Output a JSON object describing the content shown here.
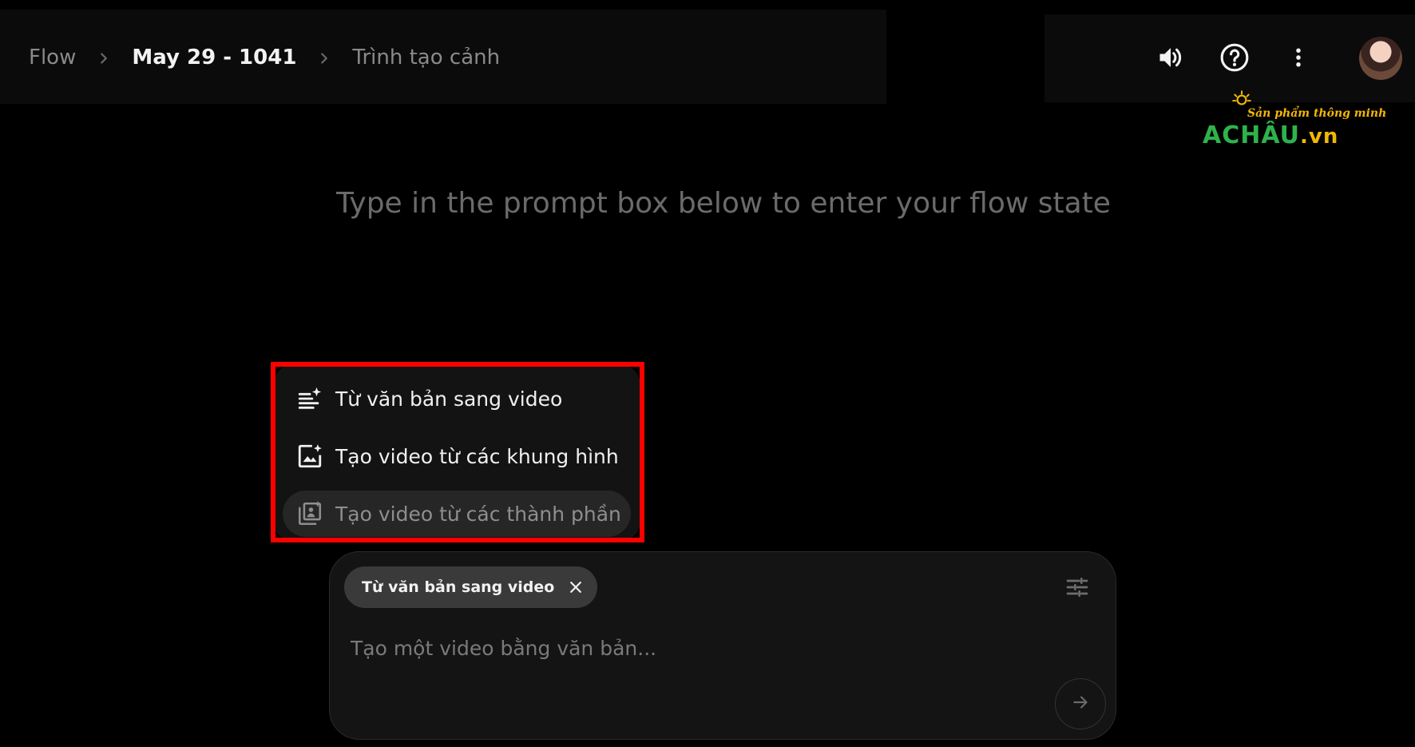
{
  "breadcrumb": {
    "items": [
      {
        "label": "Flow"
      },
      {
        "label": "May 29 - 1041"
      },
      {
        "label": "Trình tạo cảnh"
      }
    ]
  },
  "header": {
    "actions": [
      "volume-icon",
      "help-icon",
      "more-vert-icon"
    ],
    "avatar": "user-avatar"
  },
  "watermark": {
    "tagline": "Sản phẩm thông minh",
    "brand": "ACHÂU",
    "domain": ".vn"
  },
  "main": {
    "headline": "Type in the prompt box below to enter your flow state"
  },
  "mode_menu": {
    "items": [
      {
        "label": "Từ văn bản sang video",
        "icon": "text-sparkle-icon"
      },
      {
        "label": "Tạo video từ các khung hình",
        "icon": "image-sparkle-icon"
      },
      {
        "label": "Tạo video từ các thành phần",
        "icon": "ingredients-icon",
        "selected": true
      }
    ],
    "highlight_color": "#ff0000"
  },
  "prompt": {
    "chip_label": "Từ văn bản sang video",
    "placeholder": "Tạo một video bằng văn bản...",
    "value": ""
  }
}
